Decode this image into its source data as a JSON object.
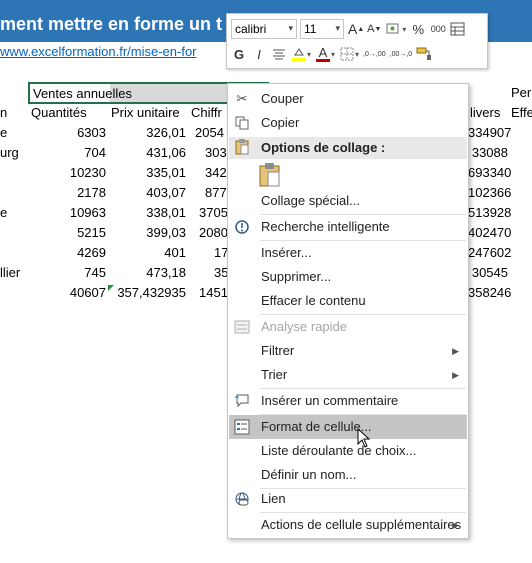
{
  "page": {
    "title": "ment mettre en forme un t",
    "link": "www.excelformation.fr/mise-en-for"
  },
  "sheet": {
    "selected_cell": "Ventes annuelles",
    "headers": {
      "col_a": "n",
      "quantites": "Quantités",
      "prix": "Prix unitaire",
      "chiffre": "Chiffr",
      "livers": "livers",
      "right_top": "Per",
      "right_bottom": "Effe"
    },
    "rows": [
      {
        "a": "e",
        "q": "6303",
        "p": "326,01",
        "c": "2054",
        "r": "334907"
      },
      {
        "a": "urg",
        "q": "704",
        "p": "431,06",
        "c": "303",
        "r": "33088"
      },
      {
        "a": "",
        "q": "10230",
        "p": "335,01",
        "c": "342",
        "r": "693340"
      },
      {
        "a": "",
        "q": "2178",
        "p": "403,07",
        "c": "877",
        "r": "102366"
      },
      {
        "a": "e",
        "q": "10963",
        "p": "338,01",
        "c": "3705",
        "r": "513928"
      },
      {
        "a": "",
        "q": "5215",
        "p": "399,03",
        "c": "2080",
        "r": "402470"
      },
      {
        "a": "",
        "q": "4269",
        "p": "401",
        "c": "17",
        "r": "247602"
      },
      {
        "a": "llier",
        "q": "745",
        "p": "473,18",
        "c": "35",
        "r": "30545"
      },
      {
        "a": "",
        "q": "40607",
        "p": "357,432935",
        "c": "1451",
        "r": "358246"
      }
    ]
  },
  "mini_toolbar": {
    "font": "calibri",
    "size": "11",
    "grow_font": "A",
    "shrink_font": "A",
    "percent": "%",
    "thousands": "000",
    "bold": "G",
    "italic": "I",
    "font_color": "A",
    "dec_more": ",0→,00",
    "dec_less": ",00→,0"
  },
  "context_menu": {
    "cut": "Couper",
    "copy": "Copier",
    "paste_options": "Options de collage :",
    "paste_special": "Collage spécial...",
    "smart_lookup": "Recherche intelligente",
    "insert": "Insérer...",
    "delete": "Supprimer...",
    "clear": "Effacer le contenu",
    "quick_analysis": "Analyse rapide",
    "filter": "Filtrer",
    "sort": "Trier",
    "insert_comment": "Insérer un commentaire",
    "format_cells": "Format de cellule...",
    "dropdown_list": "Liste déroulante de choix...",
    "define_name": "Définir un nom...",
    "link": "Lien",
    "more_actions": "Actions de cellule supplémentaires"
  },
  "colors": {
    "title_bar": "#2e75b6",
    "link": "#0563c1",
    "selection_border": "#217346",
    "menu_highlight": "#c5c5c5"
  },
  "icons": [
    "scissors-icon",
    "copy-icon",
    "clipboard-icon",
    "lightbulb-icon",
    "quick-analysis-icon",
    "comment-icon",
    "format-cells-icon",
    "link-icon",
    "format-painter-icon",
    "borders-icon",
    "fill-color-icon",
    "accounting-format-icon",
    "table-icon",
    "align-center-icon"
  ]
}
